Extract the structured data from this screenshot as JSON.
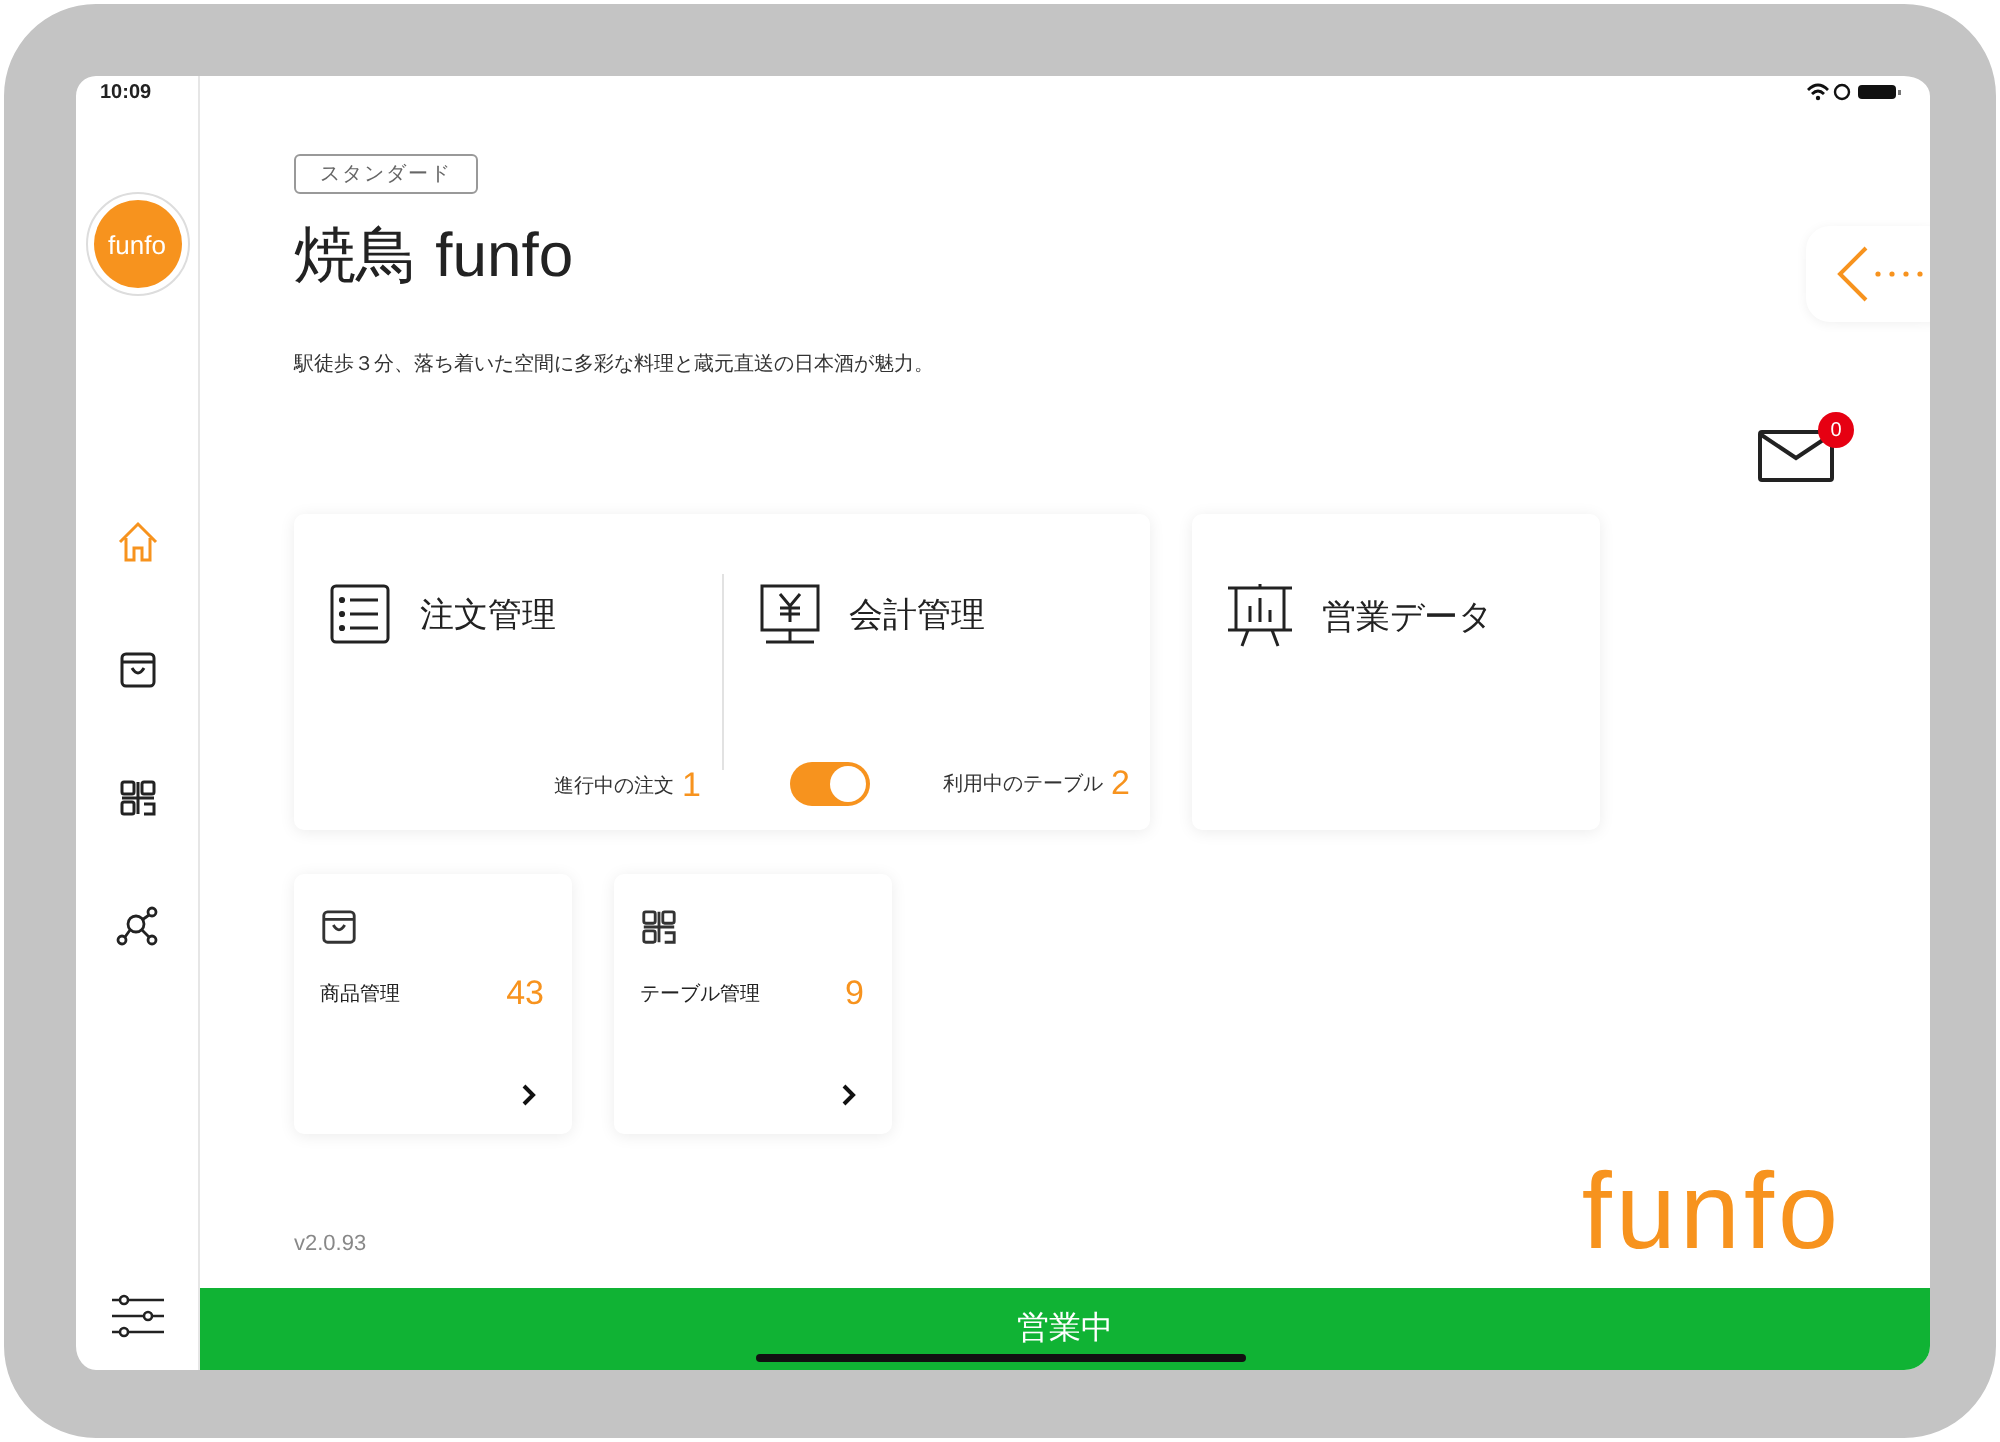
{
  "status_bar": {
    "time": "10:09"
  },
  "sidebar": {
    "logo": "funfo",
    "items": [
      {
        "kind": "home",
        "selected": true
      },
      {
        "kind": "bag",
        "selected": false
      },
      {
        "kind": "qr",
        "selected": false
      },
      {
        "kind": "network",
        "selected": false
      }
    ]
  },
  "header": {
    "plan_badge": "スタンダード",
    "title": "焼鳥 funfo",
    "description": "駅徒歩３分、落ち着いた空間に多彩な料理と蔵元直送の日本酒が魅力。"
  },
  "mail": {
    "count": "0"
  },
  "main_card": {
    "sections": [
      {
        "kind": "orders",
        "title": "注文管理",
        "footer_label": "進行中の注文",
        "footer_count": "1"
      },
      {
        "kind": "billing",
        "title": "会計管理",
        "toggle_on": true,
        "footer_label": "利用中のテーブル",
        "footer_count": "2"
      }
    ]
  },
  "sales_card": {
    "title": "営業データ"
  },
  "small_cards": [
    {
      "kind": "bag",
      "title": "商品管理",
      "count": "43"
    },
    {
      "kind": "qr",
      "title": "テーブル管理",
      "count": "9"
    }
  ],
  "version": "v2.0.93",
  "brand_logo": "funfo",
  "status_button": "営業中"
}
